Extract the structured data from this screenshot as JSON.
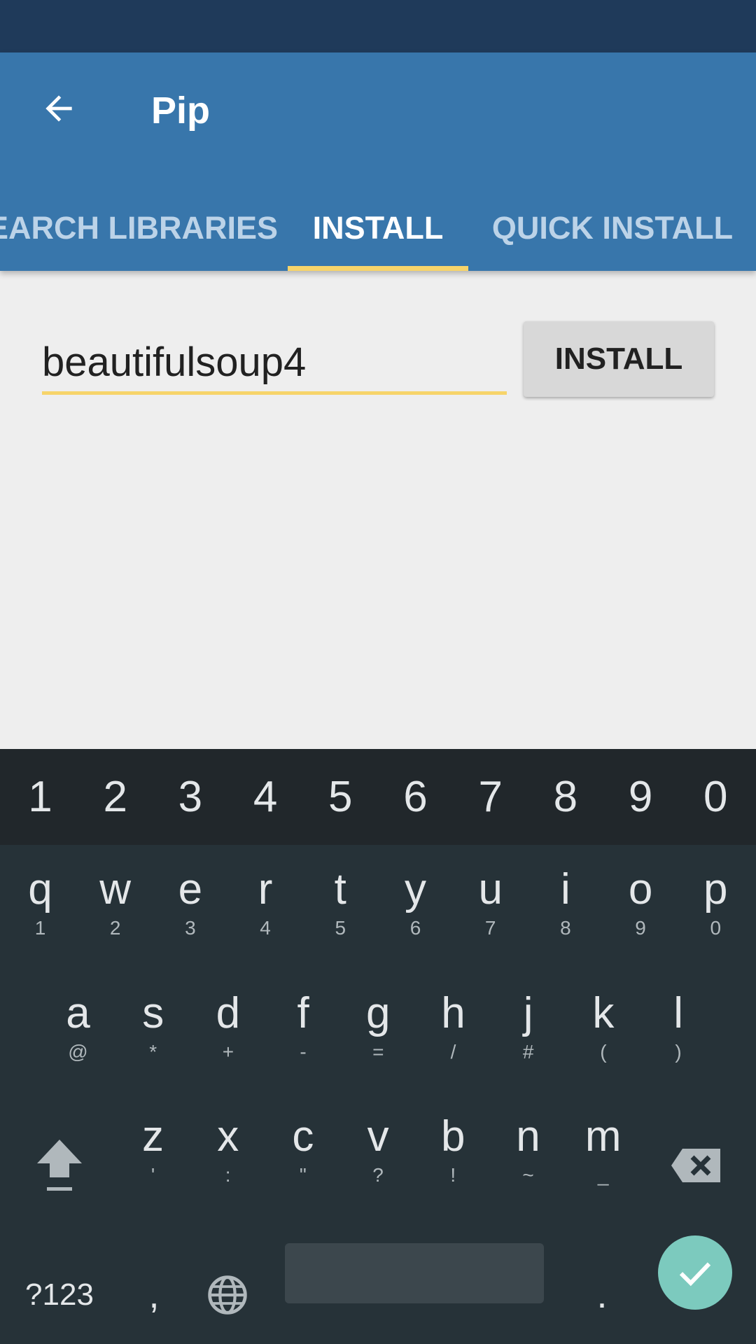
{
  "app": {
    "title": "Pip",
    "tabs": [
      {
        "label": "SEARCH LIBRARIES"
      },
      {
        "label": "INSTALL"
      },
      {
        "label": "QUICK INSTALL"
      }
    ],
    "tabs_visible": [
      "EARCH LIBRARIES",
      "INSTALL",
      "QUICK INSTALL"
    ],
    "active_tab": "INSTALL"
  },
  "install_form": {
    "package_value": "beautifulsoup4",
    "install_label": "INSTALL"
  },
  "keyboard": {
    "number_row": [
      "1",
      "2",
      "3",
      "4",
      "5",
      "6",
      "7",
      "8",
      "9",
      "0"
    ],
    "row1": [
      {
        "main": "q",
        "sub": "1"
      },
      {
        "main": "w",
        "sub": "2"
      },
      {
        "main": "e",
        "sub": "3"
      },
      {
        "main": "r",
        "sub": "4"
      },
      {
        "main": "t",
        "sub": "5"
      },
      {
        "main": "y",
        "sub": "6"
      },
      {
        "main": "u",
        "sub": "7"
      },
      {
        "main": "i",
        "sub": "8"
      },
      {
        "main": "o",
        "sub": "9"
      },
      {
        "main": "p",
        "sub": "0"
      }
    ],
    "row2": [
      {
        "main": "a",
        "sub": "@"
      },
      {
        "main": "s",
        "sub": "*"
      },
      {
        "main": "d",
        "sub": "+"
      },
      {
        "main": "f",
        "sub": "-"
      },
      {
        "main": "g",
        "sub": "="
      },
      {
        "main": "h",
        "sub": "/"
      },
      {
        "main": "j",
        "sub": "#"
      },
      {
        "main": "k",
        "sub": "("
      },
      {
        "main": "l",
        "sub": ")"
      }
    ],
    "row3": [
      {
        "main": "z",
        "sub": "'"
      },
      {
        "main": "x",
        "sub": ":"
      },
      {
        "main": "c",
        "sub": "\""
      },
      {
        "main": "v",
        "sub": "?"
      },
      {
        "main": "b",
        "sub": "!"
      },
      {
        "main": "n",
        "sub": "~"
      },
      {
        "main": "m",
        "sub": "_"
      }
    ],
    "symbols_label": "?123",
    "comma_label": ",",
    "period_label": "."
  },
  "colors": {
    "status_bar": "#1f3a5a",
    "app_bar": "#3876ab",
    "accent": "#f7d46a",
    "keyboard_bg": "#263238",
    "enter_key": "#7ccabe"
  }
}
